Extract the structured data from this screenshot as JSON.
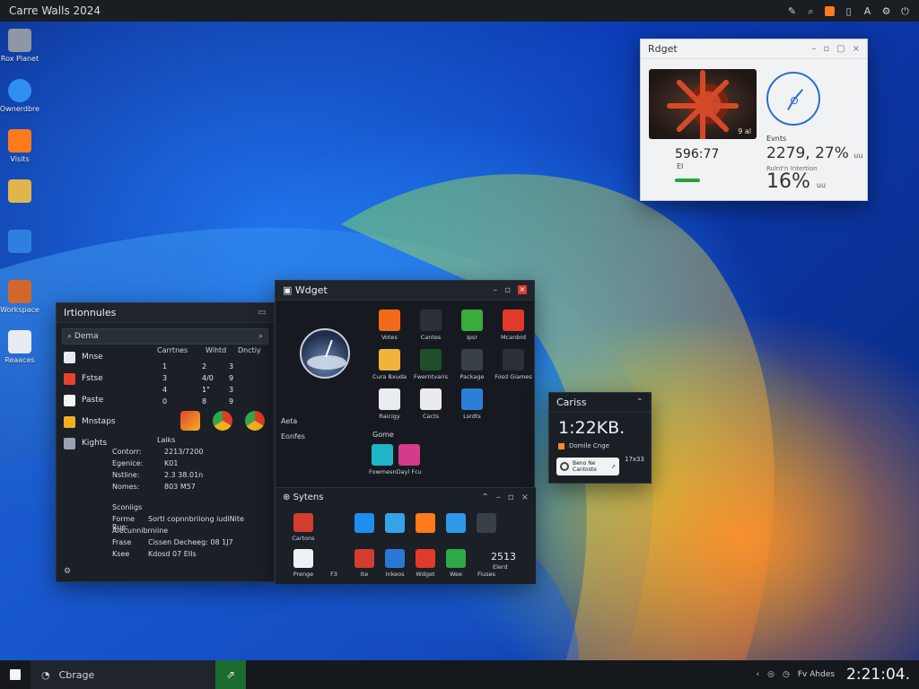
{
  "topbar": {
    "title": "Carre   Walls 2024",
    "tray_icons": [
      "brush-icon",
      "search-icon",
      "orange-app-icon",
      "doc-icon",
      "a-icon",
      "settings-icon",
      "power-icon"
    ]
  },
  "desktop": {
    "icons": [
      {
        "label": "Rox Planet",
        "icon": "computer-icon",
        "color": "#8e97a3"
      },
      {
        "label": "Ownerdbre",
        "icon": "play-icon",
        "color": "#2f8ff0"
      },
      {
        "label": "Visits",
        "icon": "folder-orange-icon",
        "color": "#ff7a1a"
      },
      {
        "label": "",
        "icon": "folder-icon",
        "color": "#e0b54a"
      },
      {
        "label": "",
        "icon": "apps-icon",
        "color": "#2f7fe0"
      },
      {
        "label": "Workspace",
        "icon": "media-icon",
        "color": "#d2672c"
      },
      {
        "label": "Reaaces",
        "icon": "document-icon",
        "color": "#e8ebf0"
      }
    ]
  },
  "widget_light": {
    "title": "Rdget",
    "photo_tag": "9 al",
    "value1": "596:77",
    "sub1": "EI",
    "label2": "Evnts",
    "value2": "2279, 27%",
    "value2_unit": "uu",
    "sub2": "Rulnt'n Intertion",
    "value3": "16%",
    "value3_unit": "uu"
  },
  "panel_left": {
    "title": "Irtionnules",
    "search_placeholder": "Dema",
    "side_items": [
      {
        "label": "Mnse",
        "color": "#e6e9ef"
      },
      {
        "label": "Fstse",
        "color": "#e5432f"
      },
      {
        "label": "Paste",
        "color": "#f3f4f6"
      },
      {
        "label": "Mnstaps",
        "color": "#f2b01e"
      },
      {
        "label": "Kights",
        "color": "#9aa3af"
      }
    ],
    "columns": [
      "Carrtnes",
      "Wihtd",
      "Dnctiy"
    ],
    "rows": [
      [
        "1",
        "2",
        "3"
      ],
      [
        "3",
        "4/0",
        "9"
      ],
      [
        "4",
        "1\"",
        "3"
      ],
      [
        "0",
        "8",
        "9"
      ]
    ],
    "details_header": "Laiks",
    "details": [
      {
        "k": "Contorr:",
        "v": "2213/7200"
      },
      {
        "k": "Egenice:",
        "v": "K01"
      },
      {
        "k": "Nstline:",
        "v": "2.3 38.01n"
      },
      {
        "k": "Nomes:",
        "v": "803 M57"
      }
    ],
    "extra_title": "Sconiigs",
    "extra_lines": [
      {
        "k": "Forme Rue:",
        "v": "Sortl copnnbriiong iudiNite"
      },
      {
        "k": "Alecunnibrniine",
        "v": ""
      },
      {
        "k": "Frase",
        "v": "Cissen Decheeg:   08 1J7"
      },
      {
        "k": "Ksee",
        "v": "Kdosd         07 EIIs"
      }
    ]
  },
  "panel_center": {
    "title": "Wdget",
    "menu": [
      "Aeta",
      "Eonfes"
    ],
    "apps": [
      {
        "name": "Votes",
        "icon": "orange-app-icon",
        "color": "#f06a18"
      },
      {
        "name": "Cantes",
        "icon": "windows-icon",
        "color": "#2b3038"
      },
      {
        "name": "Ipsr",
        "icon": "browser-icon",
        "color": "#3bab3b"
      },
      {
        "name": "Mcanbrd",
        "icon": "record-icon",
        "color": "#e23a2a"
      },
      {
        "name": "Cura Bxuda",
        "icon": "folder-icon",
        "color": "#f0b43a"
      },
      {
        "name": "Fwerntvaris",
        "icon": "terminal-icon",
        "color": "#1e4f2a"
      },
      {
        "name": "Package",
        "icon": "package-icon",
        "color": "#3a4048"
      },
      {
        "name": "Fosd Giames",
        "icon": "circles-icon",
        "color": "#2b3038"
      },
      {
        "name": "Raicigy",
        "icon": "dial-icon",
        "color": "#eaecef"
      },
      {
        "name": "Cacts",
        "icon": "contact-icon",
        "color": "#e9ebef"
      },
      {
        "name": "Lsrdts",
        "icon": "grid-icon",
        "color": "#2c7fd6"
      }
    ],
    "games_label": "Gome",
    "games": [
      {
        "name": "Fowmesn",
        "icon": "cyan-app-icon",
        "color": "#1fb5c9"
      },
      {
        "name": "Dayl Fcu",
        "icon": "pink-app-icon",
        "color": "#d63a8a"
      }
    ],
    "section_title": "Sytens",
    "system_apps": [
      {
        "name": "Cartons",
        "icon": "photos-icon",
        "color": "#d33d2f"
      },
      {
        "name": "",
        "icon": "search-icon",
        "color": "#1b1f26"
      },
      {
        "name": "",
        "icon": "edge-icon",
        "color": "#1d8ef0"
      },
      {
        "name": "",
        "icon": "folder-blue-icon",
        "color": "#36a3e8"
      },
      {
        "name": "",
        "icon": "orange-p-icon",
        "color": "#ff7a1a"
      },
      {
        "name": "",
        "icon": "folder-blue-icon",
        "color": "#2f9ae8"
      },
      {
        "name": "",
        "icon": "mail-icon",
        "color": "#3a4048"
      },
      {
        "name": "",
        "icon": "",
        "color": "#1b1f26"
      },
      {
        "name": "Prenge",
        "icon": "play-store-icon",
        "color": "#eef0f3"
      },
      {
        "name": "F3",
        "icon": "play-icon",
        "color": "#1b1f26"
      },
      {
        "name": "Ite",
        "icon": "map-icon",
        "color": "#d33d2f"
      },
      {
        "name": "Inkeos",
        "icon": "device-icon",
        "color": "#2a78d6"
      },
      {
        "name": "Wdget",
        "icon": "red-circle-icon",
        "color": "#e23a2a"
      },
      {
        "name": "Wee",
        "icon": "tree-icon",
        "color": "#2fa84a"
      },
      {
        "name": "Fiuses",
        "icon": "stats-icon",
        "color": "#1b1f26"
      },
      {
        "name": "",
        "icon": "",
        "color": "#1b1f26"
      }
    ],
    "system_value": "2513",
    "system_value_sub": "Elerd"
  },
  "widget_small": {
    "title": "Cariss",
    "value": "1:22KB.",
    "line": "Domile Cnge",
    "card_line1": "Beno Ne",
    "card_line2": "Cantoste",
    "side_value": "17x33"
  },
  "taskbar": {
    "search_text": "Cbrage",
    "active_icon": "share-icon",
    "tray_text": "Fv Ahdes",
    "clock": "2:21:04."
  }
}
